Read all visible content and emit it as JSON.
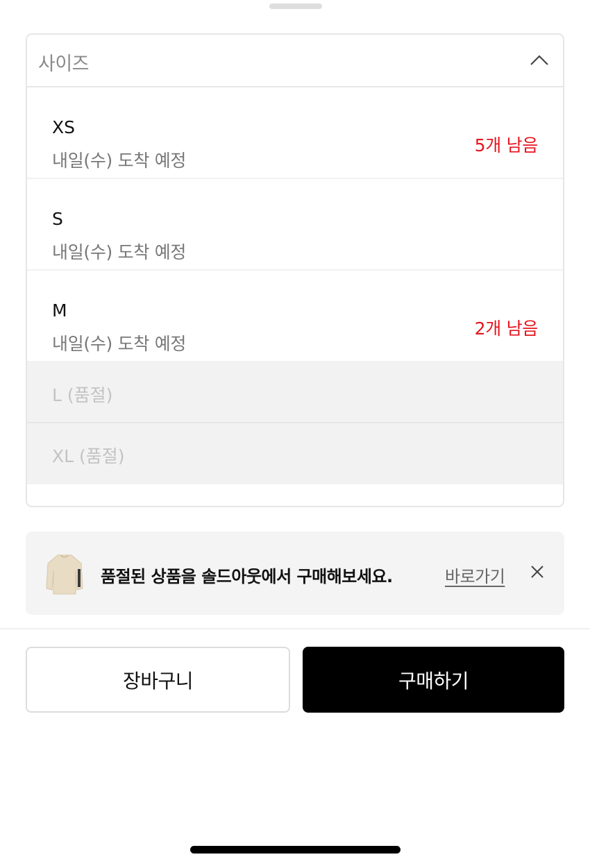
{
  "select": {
    "label": "사이즈",
    "expanded": true,
    "icon": "chevron-up-icon"
  },
  "options": [
    {
      "size": "XS",
      "eta": "내일(수) 도착 예정",
      "stock": "5개 남음"
    },
    {
      "size": "S",
      "eta": "내일(수) 도착 예정",
      "stock": ""
    },
    {
      "size": "M",
      "eta": "내일(수) 도착 예정",
      "stock": "2개 남음"
    }
  ],
  "soldout_options": [
    {
      "label": "L (품절)"
    },
    {
      "label": "XL (품절)"
    }
  ],
  "banner": {
    "image_icon": "sweater-thumbnail",
    "text": "품절된 상품을 솔드아웃에서 구매해보세요.",
    "link": "바로가기",
    "close_icon": "close-icon"
  },
  "actions": {
    "cart_label": "장바구니",
    "buy_label": "구매하기"
  },
  "colors": {
    "stock_warning": "#e6141e",
    "buy_button": "#000000",
    "soldout_bg": "#f2f2f2"
  }
}
